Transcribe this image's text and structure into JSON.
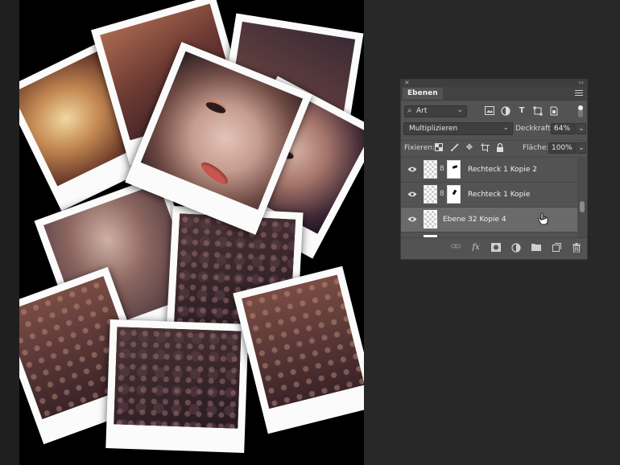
{
  "panel": {
    "close_glyph": "×",
    "collapse_glyph": "‹‹",
    "tab_label": "Ebenen"
  },
  "filter": {
    "kind_label": "Art",
    "icons": [
      "image-filter-icon",
      "adjustment-filter-icon",
      "text-filter-icon",
      "shape-filter-icon",
      "smartobject-filter-icon"
    ]
  },
  "blend": {
    "mode": "Multiplizieren",
    "opacity_label": "Deckkraft:",
    "opacity_value": "64%"
  },
  "lock": {
    "label": "Fixieren:",
    "fill_label": "Fläche:",
    "fill_value": "100%"
  },
  "layers": [
    {
      "name": "Rechteck 1 Kopie 2",
      "visible": true,
      "has_mask": true,
      "selected": false
    },
    {
      "name": "Rechteck 1 Kopie",
      "visible": true,
      "has_mask": true,
      "selected": false
    },
    {
      "name": "Ebene 32 Kopie 4",
      "visible": true,
      "has_mask": false,
      "selected": true
    }
  ],
  "footer_icons": [
    "link-layers-icon",
    "fx-icon",
    "add-mask-icon",
    "adjustment-layer-icon",
    "group-folder-icon",
    "new-layer-icon",
    "trash-icon"
  ],
  "colors": {
    "panel_bg": "#535353",
    "selected_row": "#6a6a6a",
    "canvas_bg": "#000000"
  }
}
